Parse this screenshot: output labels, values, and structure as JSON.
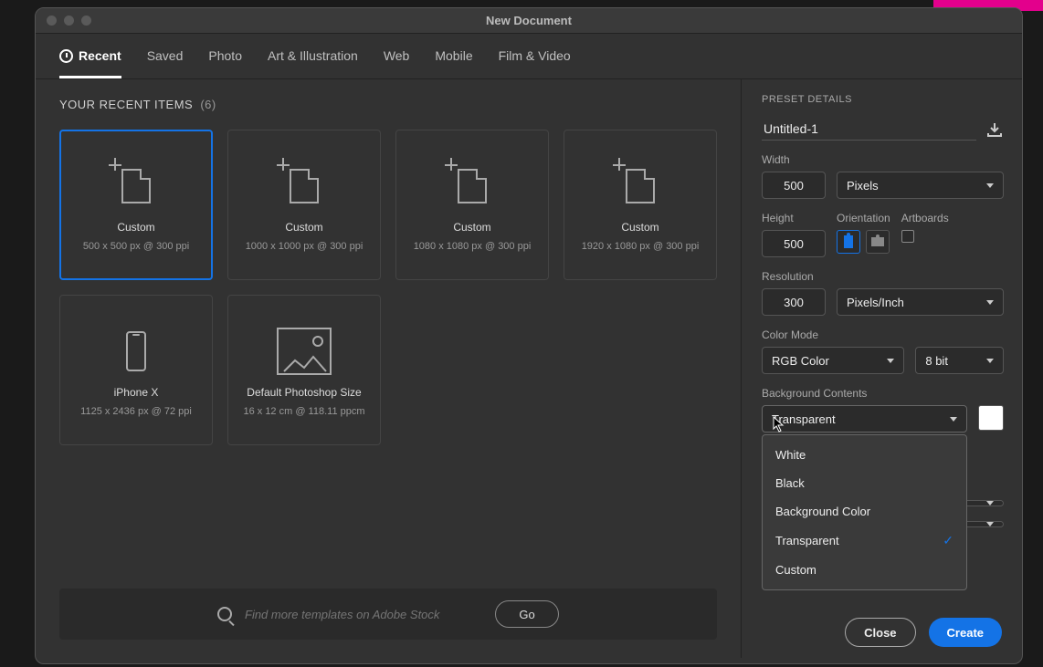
{
  "window": {
    "title": "New Document"
  },
  "tabs": [
    "Recent",
    "Saved",
    "Photo",
    "Art & Illustration",
    "Web",
    "Mobile",
    "Film & Video"
  ],
  "activeTab": 0,
  "recent": {
    "header": "YOUR RECENT ITEMS",
    "count": "(6)",
    "items": [
      {
        "name": "Custom",
        "sub": "500 x 500 px @ 300 ppi",
        "icon": "doc"
      },
      {
        "name": "Custom",
        "sub": "1000 x 1000 px @ 300 ppi",
        "icon": "doc"
      },
      {
        "name": "Custom",
        "sub": "1080 x 1080 px @ 300 ppi",
        "icon": "doc"
      },
      {
        "name": "Custom",
        "sub": "1920 x 1080 px @ 300 ppi",
        "icon": "doc"
      },
      {
        "name": "iPhone X",
        "sub": "1125 x 2436 px @ 72 ppi",
        "icon": "phone"
      },
      {
        "name": "Default Photoshop Size",
        "sub": "16 x 12 cm @ 118.11 ppcm",
        "icon": "image"
      }
    ],
    "selected": 0
  },
  "search": {
    "placeholder": "Find more templates on Adobe Stock",
    "go": "Go"
  },
  "details": {
    "header": "PRESET DETAILS",
    "name": "Untitled-1",
    "widthLabel": "Width",
    "width": "500",
    "unit": "Pixels",
    "heightLabel": "Height",
    "height": "500",
    "orientationLabel": "Orientation",
    "artboardsLabel": "Artboards",
    "resolutionLabel": "Resolution",
    "resolution": "300",
    "resolutionUnit": "Pixels/Inch",
    "colorModeLabel": "Color Mode",
    "colorMode": "RGB Color",
    "bitDepth": "8 bit",
    "bgLabel": "Background Contents",
    "bgValue": "Transparent",
    "bgOptions": [
      "White",
      "Black",
      "Background Color",
      "Transparent",
      "Custom"
    ],
    "bgSelectedIndex": 3
  },
  "footer": {
    "close": "Close",
    "create": "Create"
  }
}
